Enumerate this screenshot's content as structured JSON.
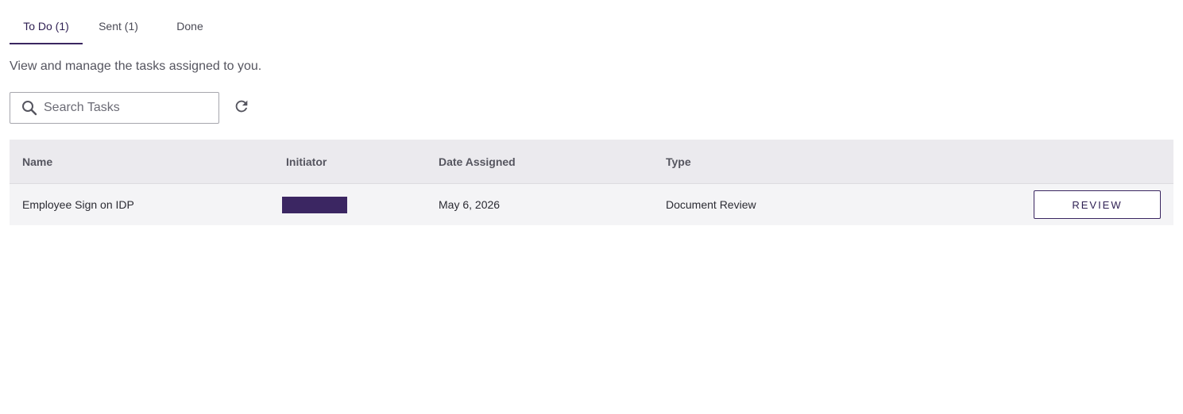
{
  "tabs": [
    {
      "label": "To Do (1)",
      "active": true
    },
    {
      "label": "Sent (1)",
      "active": false
    },
    {
      "label": "Done",
      "active": false
    }
  ],
  "subtitle": "View and manage the tasks assigned to you.",
  "search": {
    "placeholder": "Search Tasks",
    "value": ""
  },
  "icons": {
    "search": "search-icon",
    "refresh": "refresh-icon"
  },
  "table": {
    "headers": [
      "Name",
      "Initiator",
      "Date Assigned",
      "Type"
    ],
    "rows": [
      {
        "name": "Employee Sign on IDP",
        "initiator": "[redacted]",
        "date_assigned": "May 6, 2026",
        "type": "Document Review",
        "action": "REVIEW"
      }
    ]
  },
  "colors": {
    "accent": "#3a2660",
    "header_bg": "#ebeaee",
    "row_bg": "#f4f4f6"
  }
}
